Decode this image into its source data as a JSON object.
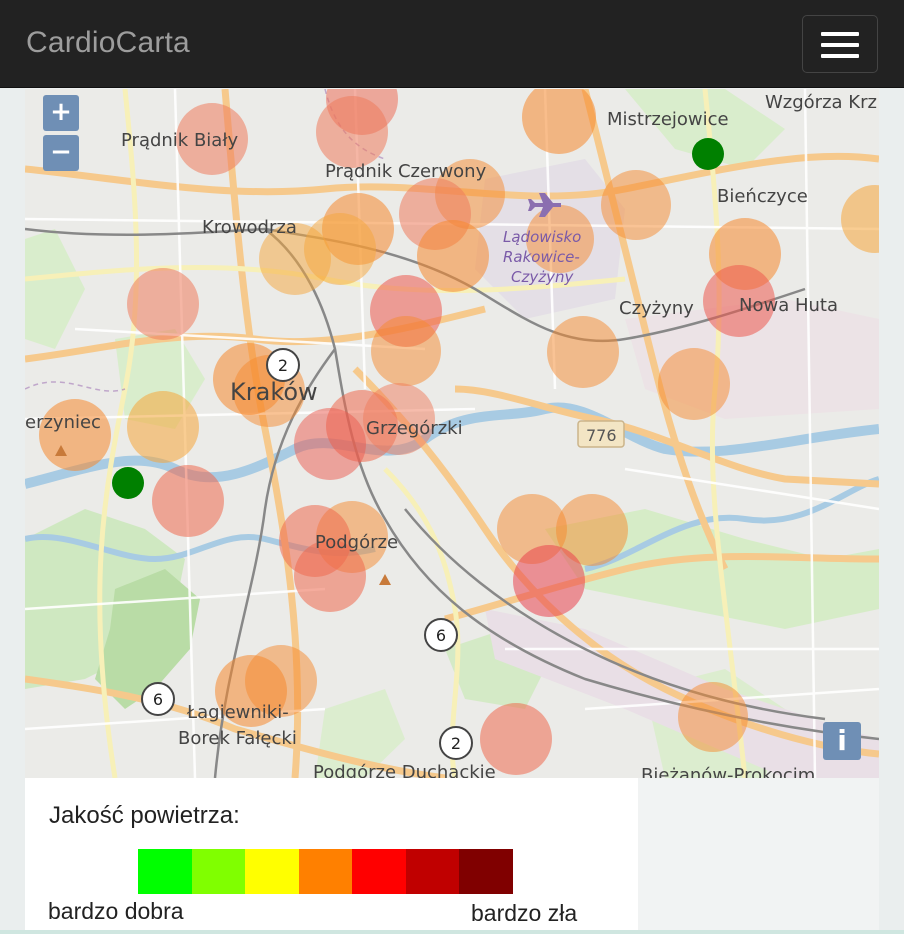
{
  "navbar": {
    "brand": "CardioCarta"
  },
  "map": {
    "zoom_in": "+",
    "zoom_out": "−",
    "info": "i",
    "labels": {
      "pradnik_bialy": "Prądnik Biały",
      "pradnik_czerwony": "Prądnik Czerwony",
      "mistrzejowice": "Mistrzejowice",
      "wzgorza": "Wzgórza Krz",
      "krowodrza": "Krowodrza",
      "lotnisko_1": "Lądowisko",
      "lotnisko_2": "Rakowice-",
      "lotnisko_3": "Czyżyny",
      "bienczyce": "Bieńczyce",
      "czyzyny": "Czyżyny",
      "nowa_huta": "Nowa Huta",
      "krakow": "Kraków",
      "zwierzyniec": "erzyniec",
      "grzegorzki": "Grzegórzki",
      "road_776": "776",
      "podgorze": "Podgórze",
      "lagiewniki_1": "Łagiewniki-",
      "lagiewniki_2": "Borek Fałęcki",
      "podgorze_duchackie": "Podgórze Duchackie",
      "biezanow": "Bieżanów-Prokocim"
    },
    "clusters": [
      "2",
      "6",
      "6",
      "2"
    ],
    "sensor_colors": {
      "green": "#008000",
      "orange": "#f5892e",
      "red": "#ec4b3e",
      "yellow_orange": "#f2a531"
    }
  },
  "legend": {
    "title": "Jakość powietrza:",
    "scale_colors": [
      "#00ff00",
      "#80ff00",
      "#ffff00",
      "#ff8000",
      "#ff0000",
      "#c00000",
      "#800000"
    ],
    "low_label": "bardzo dobra",
    "high_label": "bardzo zła"
  }
}
